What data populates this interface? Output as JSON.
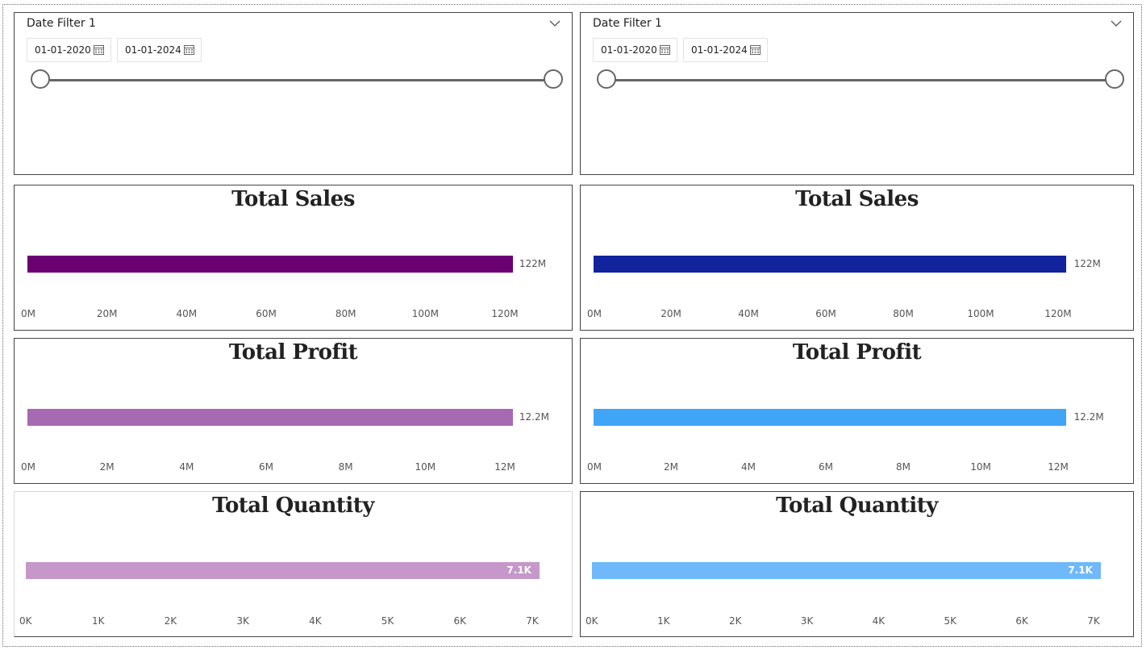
{
  "slicers": [
    {
      "title": "Date Filter 1",
      "start_date": "01-01-2020",
      "end_date": "01-01-2024",
      "range_start_fraction": 0,
      "range_end_fraction": 1
    },
    {
      "title": "Date Filter 1",
      "start_date": "01-01-2020",
      "end_date": "01-01-2024",
      "range_start_fraction": 0,
      "range_end_fraction": 1
    }
  ],
  "icons": {
    "dropdown": "chevron-down-icon",
    "calendar": "calendar-icon"
  },
  "chart_data": [
    {
      "type": "bar",
      "orientation": "horizontal",
      "title": "Total Sales",
      "values": [
        122
      ],
      "unit": "M",
      "data_label": "122M",
      "xlim": [
        0,
        120
      ],
      "ticks": [
        "0M",
        "20M",
        "40M",
        "60M",
        "80M",
        "100M",
        "120M"
      ],
      "color": "#6b0073"
    },
    {
      "type": "bar",
      "orientation": "horizontal",
      "title": "Total Sales",
      "values": [
        122
      ],
      "unit": "M",
      "data_label": "122M",
      "xlim": [
        0,
        120
      ],
      "ticks": [
        "0M",
        "20M",
        "40M",
        "60M",
        "80M",
        "100M",
        "120M"
      ],
      "color": "#12239e"
    },
    {
      "type": "bar",
      "orientation": "horizontal",
      "title": "Total Profit",
      "values": [
        12.2
      ],
      "unit": "M",
      "data_label": "12.2M",
      "xlim": [
        0,
        12
      ],
      "ticks": [
        "0M",
        "2M",
        "4M",
        "6M",
        "8M",
        "10M",
        "12M"
      ],
      "color": "#a66ab3"
    },
    {
      "type": "bar",
      "orientation": "horizontal",
      "title": "Total Profit",
      "values": [
        12.2
      ],
      "unit": "M",
      "data_label": "12.2M",
      "xlim": [
        0,
        12
      ],
      "ticks": [
        "0M",
        "2M",
        "4M",
        "6M",
        "8M",
        "10M",
        "12M"
      ],
      "color": "#41a5f7"
    },
    {
      "type": "bar",
      "orientation": "horizontal",
      "title": "Total Quantity",
      "values": [
        7.1
      ],
      "unit": "K",
      "data_label": "7.1K",
      "xlim": [
        0,
        7
      ],
      "ticks": [
        "0K",
        "1K",
        "2K",
        "3K",
        "4K",
        "5K",
        "6K",
        "7K"
      ],
      "color": "#c698ca"
    },
    {
      "type": "bar",
      "orientation": "horizontal",
      "title": "Total Quantity",
      "values": [
        7.1
      ],
      "unit": "K",
      "data_label": "7.1K",
      "xlim": [
        0,
        7
      ],
      "ticks": [
        "0K",
        "1K",
        "2K",
        "3K",
        "4K",
        "5K",
        "6K",
        "7K"
      ],
      "color": "#6fb9fb"
    }
  ]
}
